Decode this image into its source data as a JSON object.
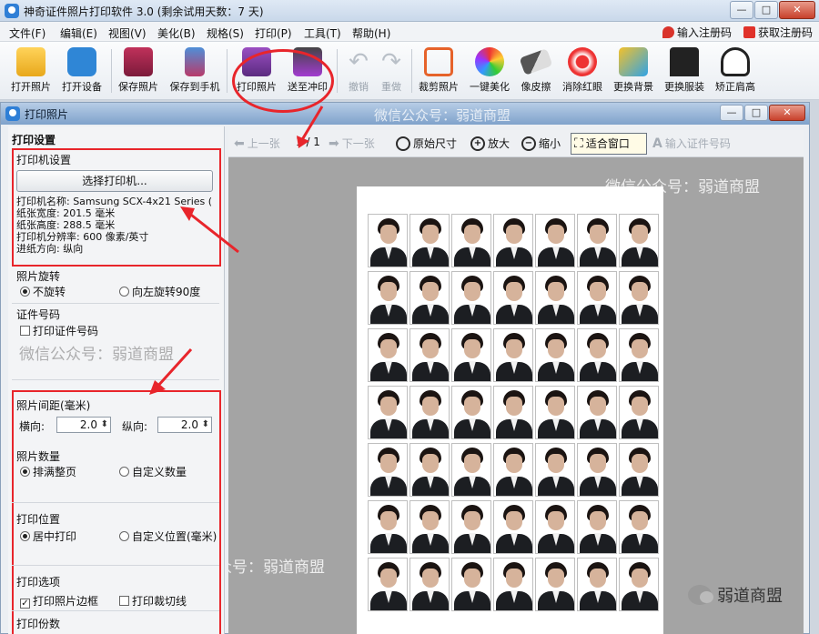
{
  "app": {
    "title": "神奇证件照片打印软件 3.0 (剩余试用天数：7 天)",
    "window_buttons": [
      "—",
      "□",
      "✕"
    ]
  },
  "menu": {
    "items": [
      "文件(F)",
      "编辑(E)",
      "视图(V)",
      "美化(B)",
      "规格(S)",
      "打印(P)",
      "工具(T)",
      "帮助(H)"
    ],
    "register_code": "输入注册码",
    "get_register_code": "获取注册码"
  },
  "toolbar": {
    "buttons": [
      {
        "label": "打开照片",
        "icon": "folder-open-icon"
      },
      {
        "label": "打开设备",
        "icon": "camera-icon"
      },
      {
        "label": "保存照片",
        "icon": "save-icon"
      },
      {
        "label": "保存到手机",
        "icon": "phone-save-icon"
      },
      {
        "label": "打印照片",
        "icon": "printer-icon"
      },
      {
        "label": "送至冲印",
        "icon": "print-service-icon"
      },
      {
        "label": "撤销",
        "icon": "undo-icon"
      },
      {
        "label": "重做",
        "icon": "redo-icon"
      },
      {
        "label": "裁剪照片",
        "icon": "crop-icon"
      },
      {
        "label": "一键美化",
        "icon": "beautify-icon"
      },
      {
        "label": "像皮擦",
        "icon": "eraser-icon"
      },
      {
        "label": "消除红眼",
        "icon": "red-eye-icon"
      },
      {
        "label": "更换背景",
        "icon": "background-icon"
      },
      {
        "label": "更换服装",
        "icon": "suit-icon"
      },
      {
        "label": "矫正肩高",
        "icon": "shoulder-icon"
      }
    ]
  },
  "dialog": {
    "title": "打印照片",
    "watermark": "微信公众号：弱道商盟"
  },
  "print_settings": {
    "heading": "打印设置",
    "printer_section": "打印机设置",
    "select_printer_button": "选择打印机...",
    "printer_name": "打印机名称: Samsung SCX-4x21 Series (",
    "paper_width": "纸张宽度: 201.5 毫米",
    "paper_height": "纸张高度: 288.5 毫米",
    "resolution": "打印机分辨率: 600 像素/英寸",
    "feed_direction": "进纸方向: 纵向",
    "rotation_section": "照片旋转",
    "rotation_options": [
      "不旋转",
      "向左旋转90度"
    ],
    "id_number_section": "证件号码",
    "print_id_number": "打印证件号码",
    "watermark": "微信公众号：弱道商盟",
    "spacing_section": "照片间距(毫米)",
    "horizontal_label": "横向:",
    "horizontal_value": "2.0",
    "vertical_label": "纵向:",
    "vertical_value": "2.0",
    "quantity_section": "照片数量",
    "quantity_options": [
      "排满整页",
      "自定义数量"
    ],
    "position_section": "打印位置",
    "position_options": [
      "居中打印",
      "自定义位置(毫米)"
    ],
    "options_section": "打印选项",
    "print_border": "打印照片边框",
    "print_cut_lines": "打印裁切线",
    "copies_section": "打印份数"
  },
  "preview_toolbar": {
    "prev": "上一张",
    "page": "1 / 1",
    "next": "下一张",
    "original_size": "原始尺寸",
    "zoom_in": "放大",
    "zoom_out": "缩小",
    "fit_window": "适合窗口",
    "enter_id": "输入证件号码"
  },
  "preview": {
    "watermark_top": "微信公众号：弱道商盟",
    "watermark_bottom": "微信公众号：弱道商盟",
    "photo_rows": 7,
    "photo_cols": 7
  },
  "corner_watermark": "弱道商盟",
  "colors": {
    "annotation_red": "#e8252b",
    "title_bar": "#c9d8ea"
  }
}
